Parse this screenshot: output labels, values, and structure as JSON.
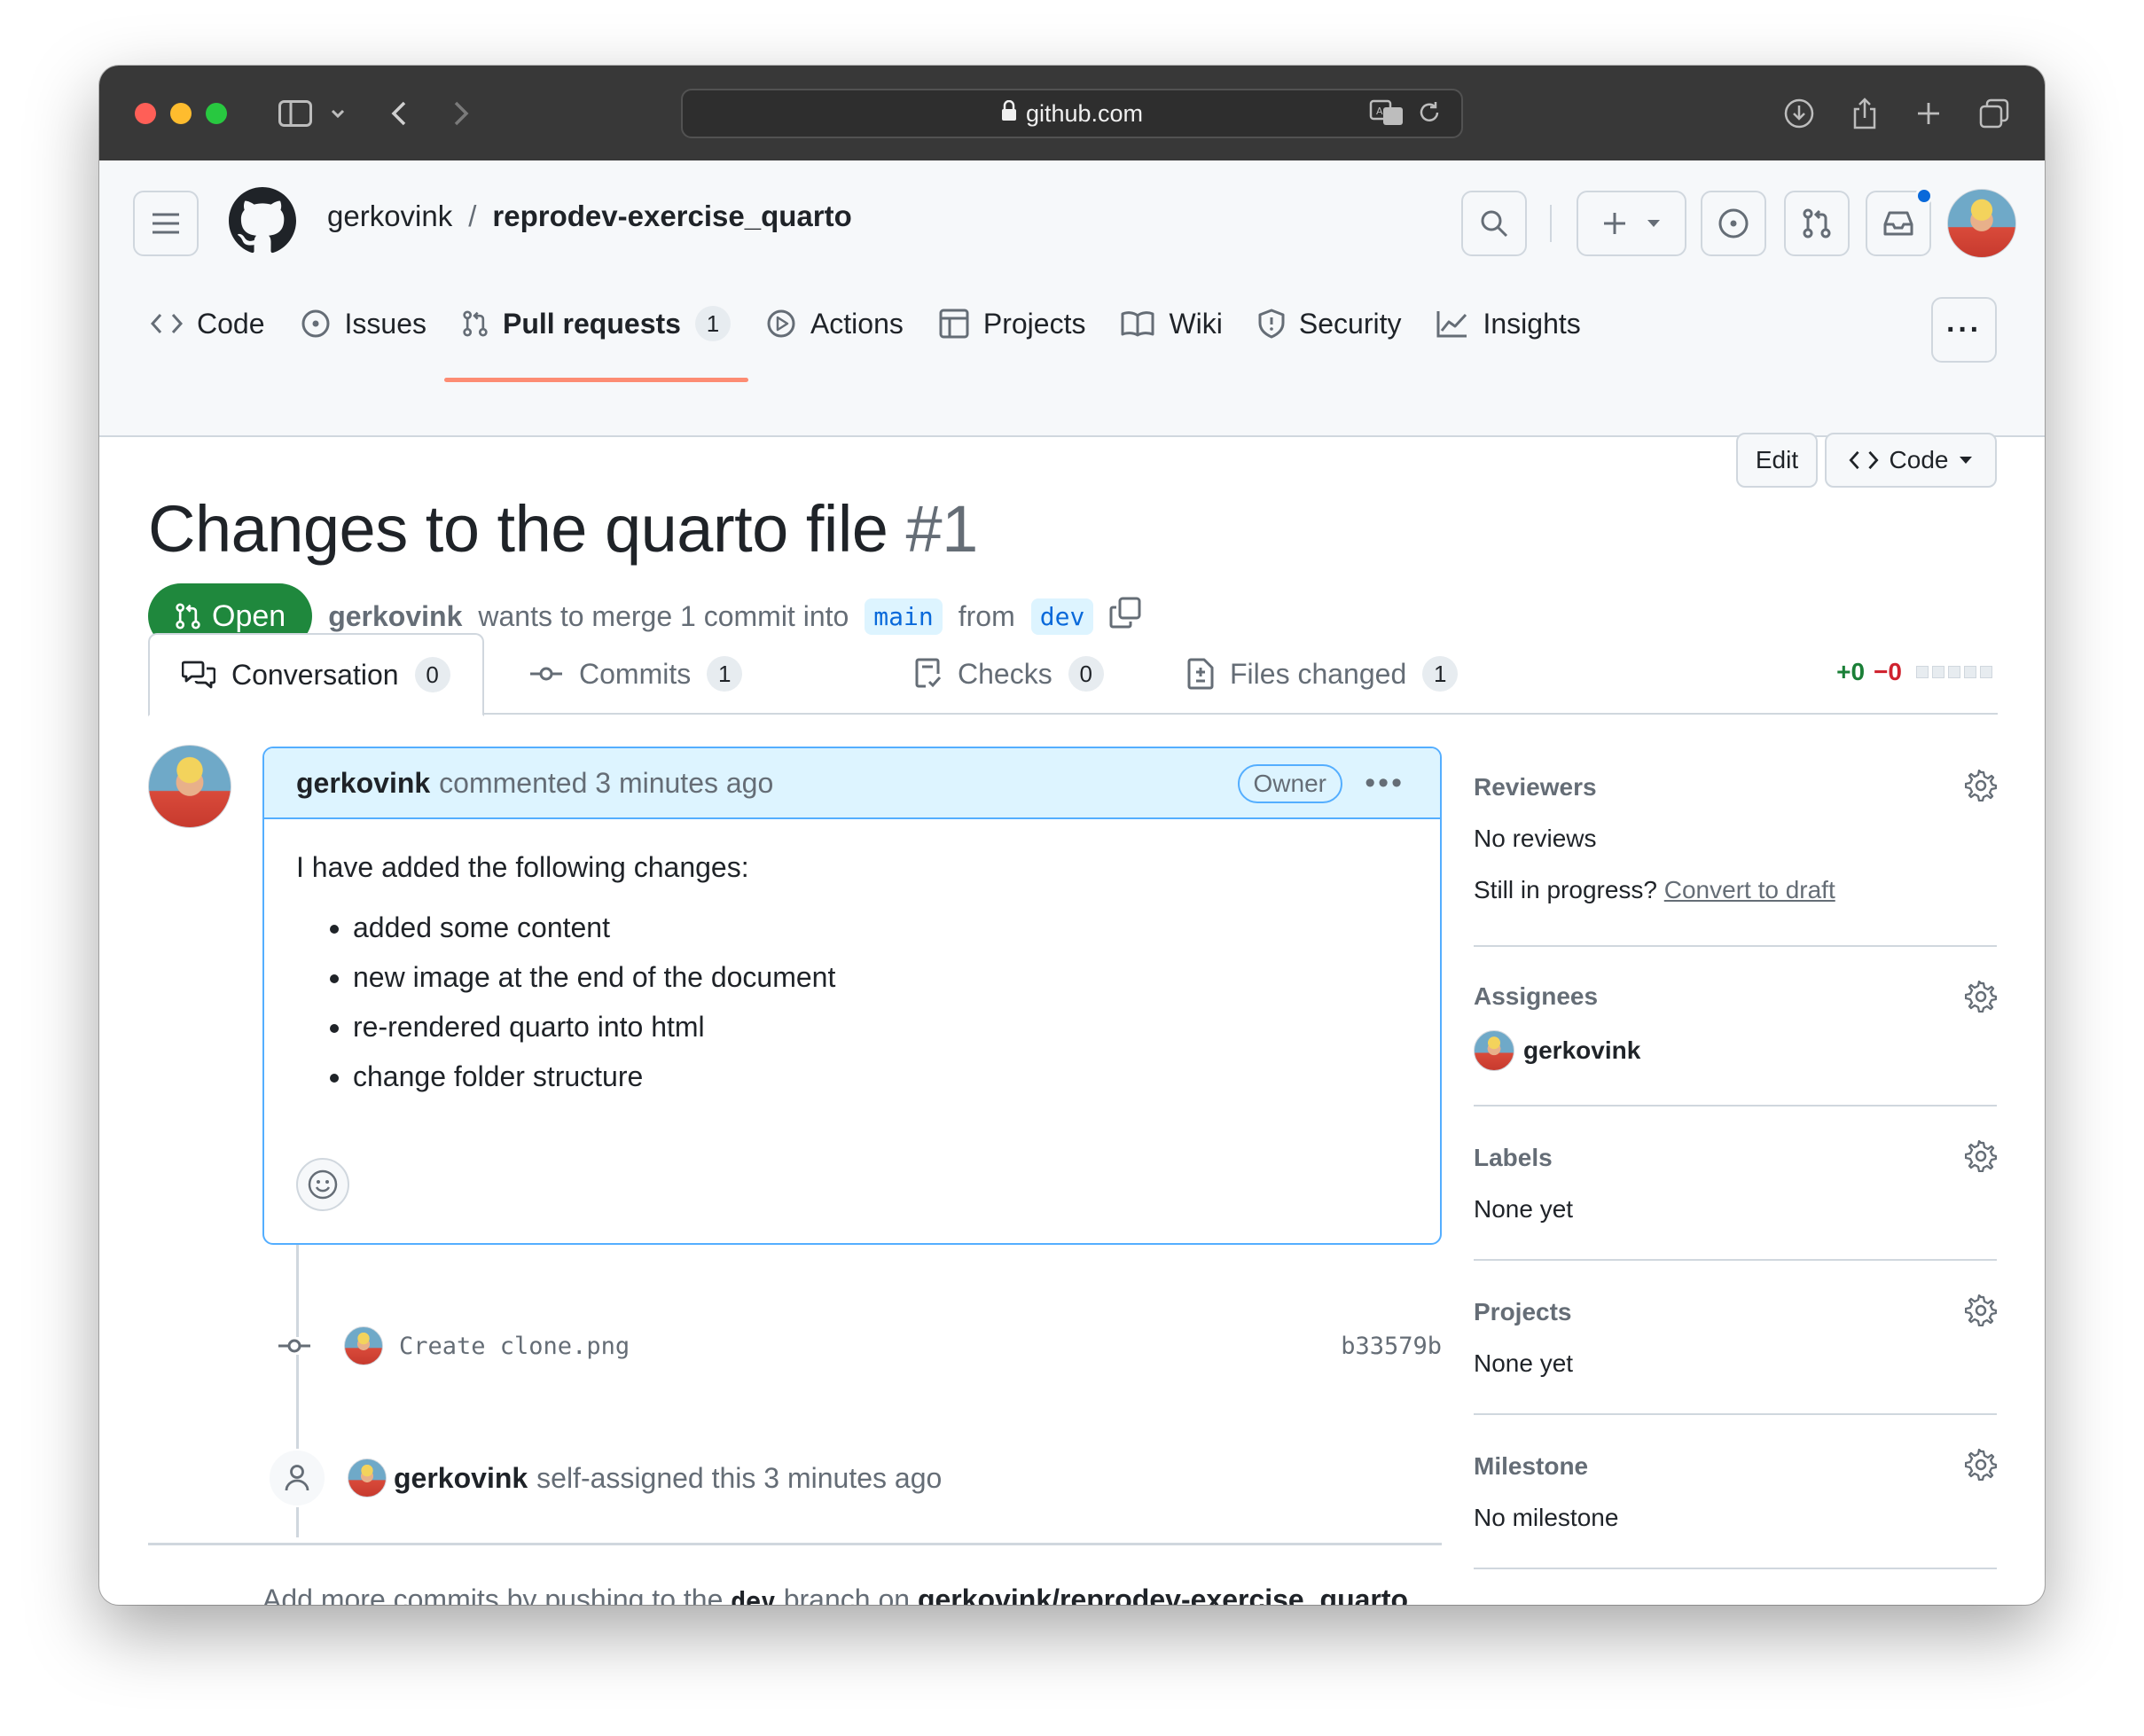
{
  "browser": {
    "url": "github.com"
  },
  "repo": {
    "owner": "gerkovink",
    "separator": "/",
    "name": "reprodev-exercise_quarto"
  },
  "nav": {
    "tabs": [
      {
        "label": "Code"
      },
      {
        "label": "Issues"
      },
      {
        "label": "Pull requests",
        "count": "1",
        "active": true
      },
      {
        "label": "Actions"
      },
      {
        "label": "Projects"
      },
      {
        "label": "Wiki"
      },
      {
        "label": "Security"
      },
      {
        "label": "Insights"
      }
    ],
    "more": "···"
  },
  "pr": {
    "title": "Changes to the quarto file",
    "number": "#1",
    "edit_label": "Edit",
    "code_label": "Code",
    "state": "Open",
    "author": "gerkovink",
    "merge_text": "wants to merge 1 commit into",
    "base_branch": "main",
    "from_text": "from",
    "head_branch": "dev"
  },
  "pr_tabs": [
    {
      "label": "Conversation",
      "count": "0"
    },
    {
      "label": "Commits",
      "count": "1"
    },
    {
      "label": "Checks",
      "count": "0"
    },
    {
      "label": "Files changed",
      "count": "1"
    }
  ],
  "diffstat": {
    "additions": "+0",
    "deletions": "−0"
  },
  "comment": {
    "author": "gerkovink",
    "action": "commented 3 minutes ago",
    "badge": "Owner",
    "intro": "I have added the following changes:",
    "items": [
      "added some content",
      "new image at the end of the document",
      "re-rendered quarto into html",
      "change folder structure"
    ]
  },
  "commit": {
    "message": "Create clone.png",
    "sha": "b33579b"
  },
  "event": {
    "actor": "gerkovink",
    "text": "self-assigned this 3 minutes ago"
  },
  "footer": {
    "prefix": "Add more commits by pushing to the",
    "branch": "dev",
    "middle": "branch on",
    "repo_link": "gerkovink/reprodev-exercise_quarto",
    "suffix": "."
  },
  "sidebar": {
    "reviewers": {
      "title": "Reviewers",
      "value": "No reviews",
      "progress_text": "Still in progress?",
      "convert_link": "Convert to draft"
    },
    "assignees": {
      "title": "Assignees",
      "user": "gerkovink"
    },
    "labels": {
      "title": "Labels",
      "value": "None yet"
    },
    "projects": {
      "title": "Projects",
      "value": "None yet"
    },
    "milestone": {
      "title": "Milestone",
      "value": "No milestone"
    }
  },
  "colors": {
    "accent_green": "#1f883d",
    "link_blue": "#0969da",
    "tab_underline": "#fd8c73",
    "notification_dot": "#0969da"
  }
}
